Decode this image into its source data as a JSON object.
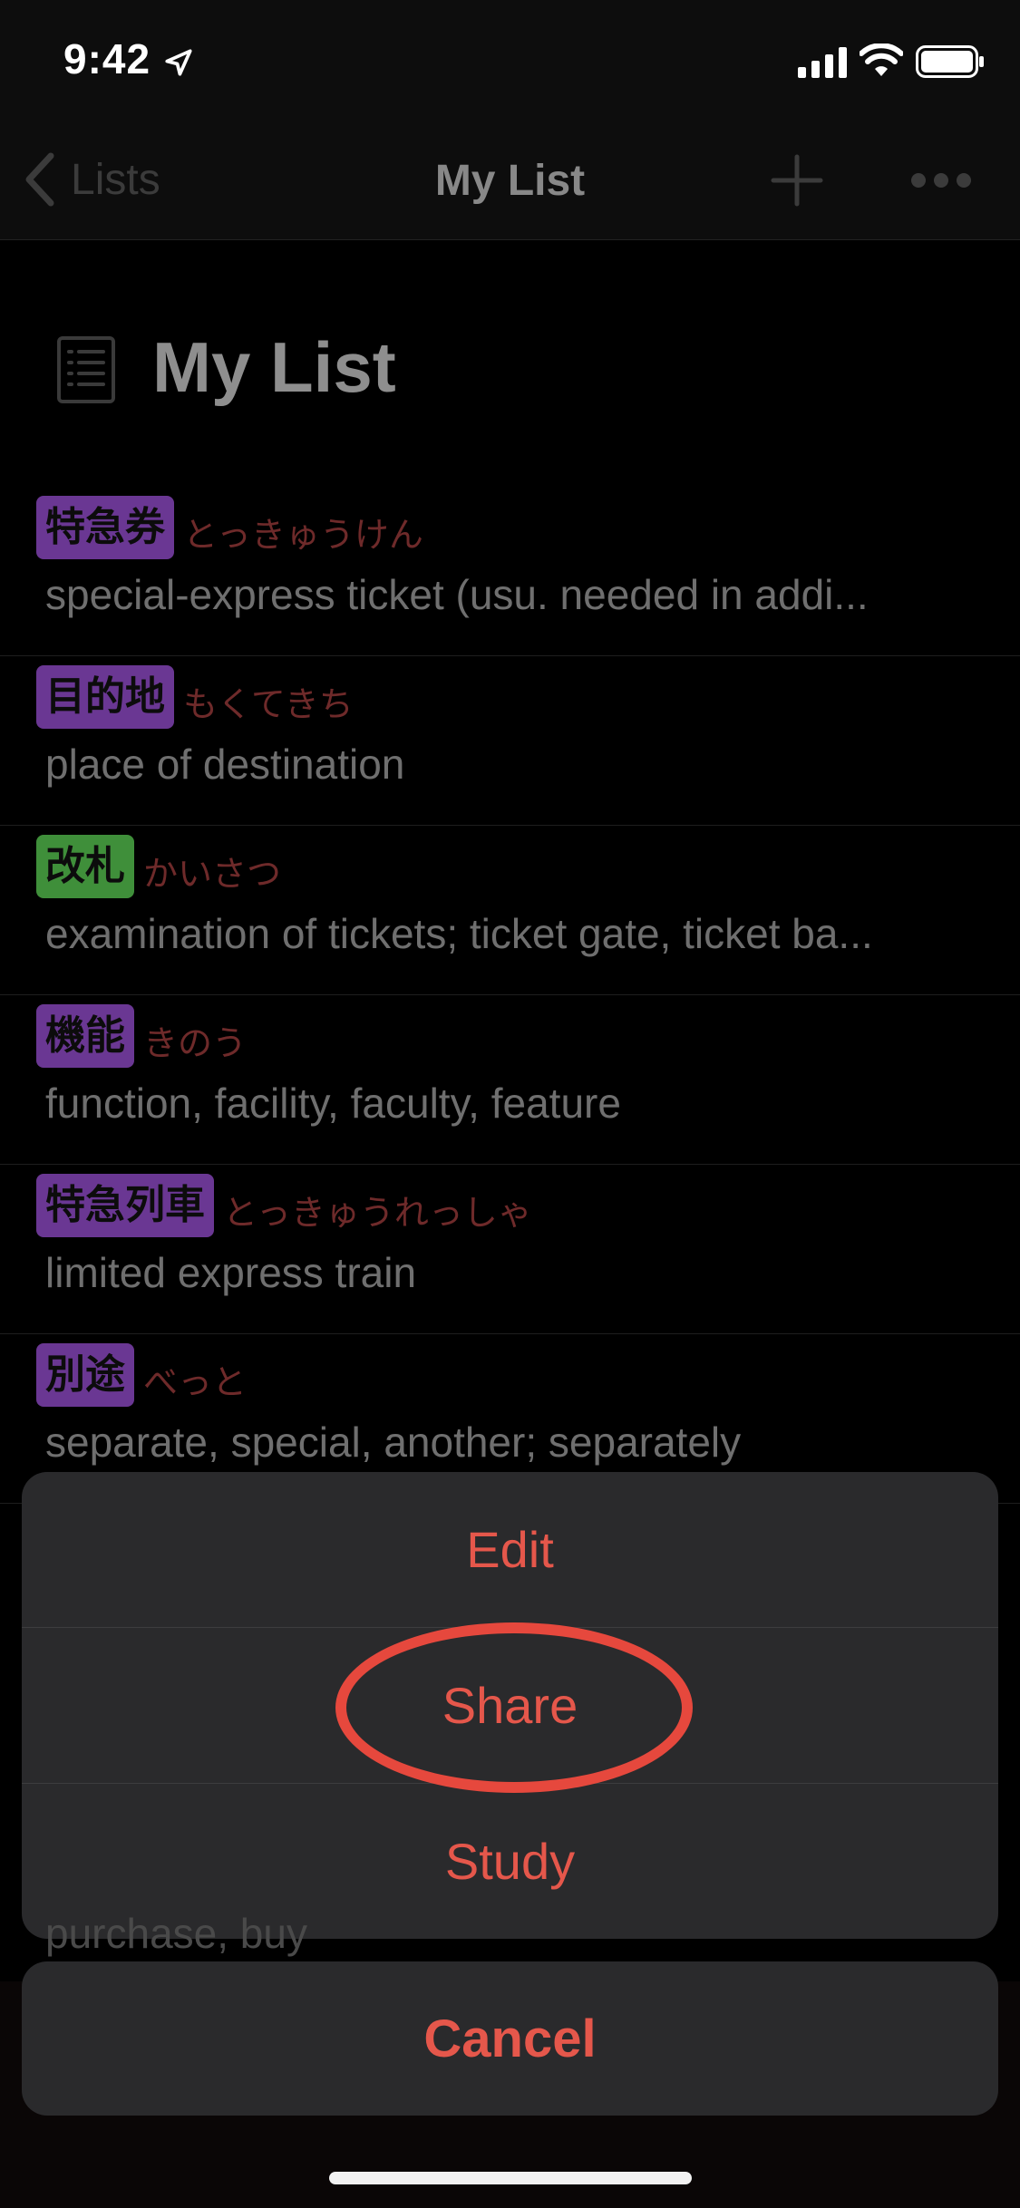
{
  "status_bar": {
    "time": "9:42"
  },
  "nav": {
    "back_label": "Lists",
    "title": "My List"
  },
  "header": {
    "title": "My List"
  },
  "colors": {
    "purple": "#6a3793",
    "green": "#3f8f3a",
    "accent": "#e5574b"
  },
  "rows": [
    {
      "kanji": "特急券",
      "reading": "とっきゅうけん",
      "meaning": "special-express ticket (usu. needed in addi...",
      "tag_color": "purple"
    },
    {
      "kanji": "目的地",
      "reading": "もくてきち",
      "meaning": "place of destination",
      "tag_color": "purple"
    },
    {
      "kanji": "改札",
      "reading": "かいさつ",
      "meaning": "examination of tickets; ticket gate, ticket ba...",
      "tag_color": "green"
    },
    {
      "kanji": "機能",
      "reading": "きのう",
      "meaning": "function, facility, faculty, feature",
      "tag_color": "purple"
    },
    {
      "kanji": "特急列車",
      "reading": "とっきゅうれっしゃ",
      "meaning": "limited express train",
      "tag_color": "purple"
    },
    {
      "kanji": "別途",
      "reading": "べっと",
      "meaning": "separate, special, another; separately",
      "tag_color": "purple"
    }
  ],
  "peek_text": "purchase, buy",
  "action_sheet": {
    "items": [
      "Edit",
      "Share",
      "Study"
    ],
    "cancel": "Cancel"
  }
}
